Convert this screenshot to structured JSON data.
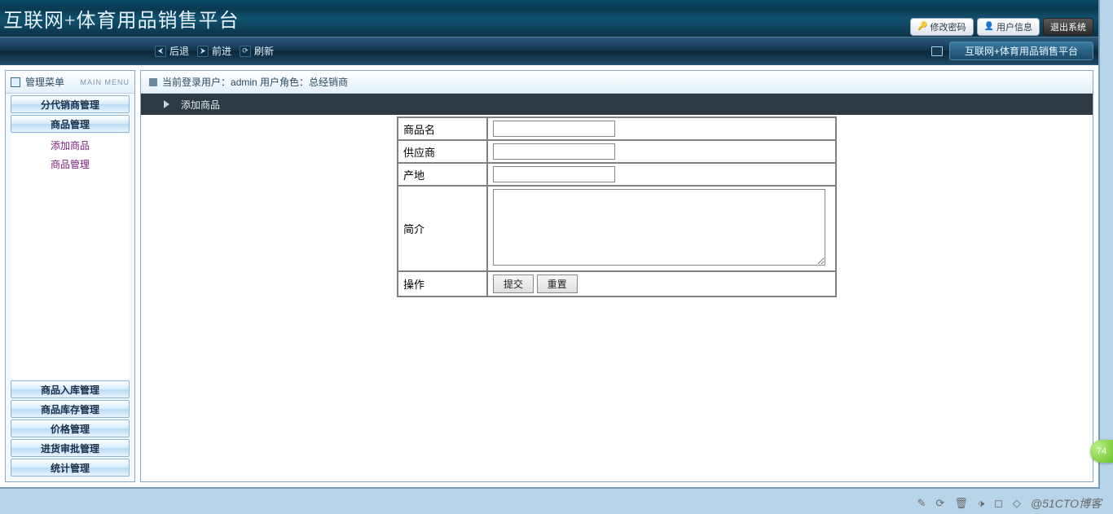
{
  "app": {
    "title": "互联网+体育用品销售平台",
    "subnav_label": "互联网+体育用品销售平台"
  },
  "header_buttons": {
    "change_password": "修改密码",
    "user_info": "用户信息",
    "logout": "退出系统"
  },
  "subnav": {
    "back": "后退",
    "forward": "前进",
    "refresh": "刷新"
  },
  "sidebar": {
    "header": "管理菜单",
    "header_sub": "MAIN MENU",
    "top_items": [
      "分代销商管理",
      "商品管理"
    ],
    "submenu": [
      "添加商品",
      "商品管理"
    ],
    "bottom_items": [
      "商品入库管理",
      "商品库存管理",
      "价格管理",
      "进货审批管理",
      "统计管理"
    ]
  },
  "content": {
    "login_info_prefix": "当前登录用户：",
    "login_user": "admin",
    "role_prefix": " 用户角色：",
    "role": "总经销商",
    "breadcrumb": "添加商品"
  },
  "form": {
    "fields": {
      "product_name": "商品名",
      "supplier": "供应商",
      "origin": "产地",
      "intro": "简介",
      "action": "操作"
    },
    "buttons": {
      "submit": "提交",
      "reset": "重置"
    }
  },
  "footer": {
    "watermark": "@51CTO博客",
    "badge": "74"
  }
}
